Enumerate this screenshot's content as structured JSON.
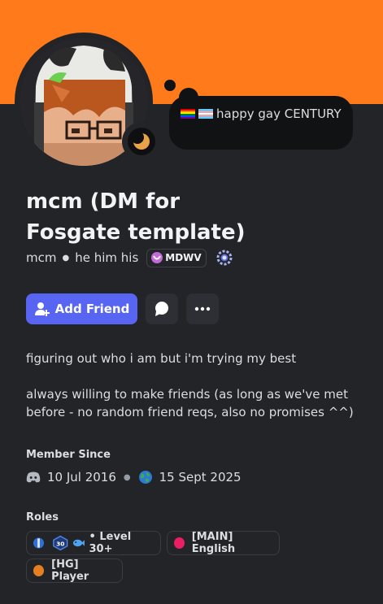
{
  "status": {
    "text": "happy gay CENTURY"
  },
  "profile": {
    "display_name": "mcm (DM for Fosgate template)",
    "username": "mcm",
    "pronouns": "he him his",
    "guild_tag": "MDWV"
  },
  "actions": {
    "add_friend_label": "Add Friend"
  },
  "bio": {
    "line1": "figuring out who i am but i'm trying my best",
    "line2": "always willing to make friends (as long as we've met before - no random friend reqs, also no promises ^^)"
  },
  "member_since": {
    "heading": "Member Since",
    "discord_date": "10 Jul 2016",
    "server_date": "15 Sept 2025"
  },
  "roles": {
    "heading": "Roles",
    "items": [
      {
        "name": "• Level 30+",
        "badge": "30"
      },
      {
        "name": "[MAIN] English",
        "color": "#e91e63"
      },
      {
        "name": "[HG] Player",
        "color": "#e67e22"
      }
    ]
  },
  "colors": {
    "banner": "#ff7a1a",
    "accent": "#5865f2",
    "background": "#232428"
  }
}
